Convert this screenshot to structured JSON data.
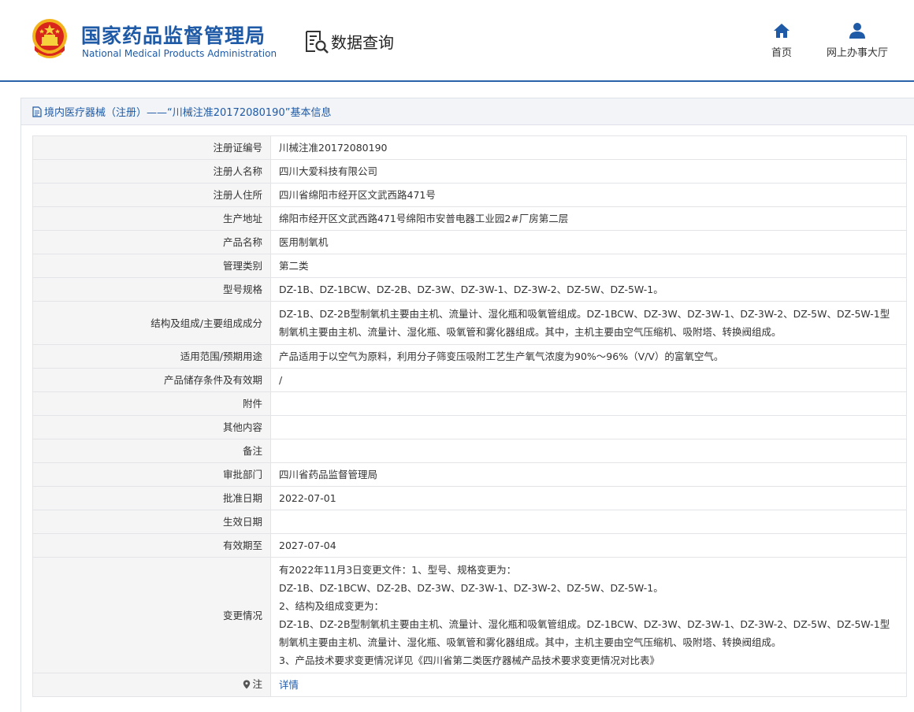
{
  "header": {
    "site_title_cn": "国家药品监督管理局",
    "site_title_en": "National Medical Products Administration",
    "section_label": "数据查询",
    "nav": [
      {
        "label": "首页",
        "icon": "home-icon"
      },
      {
        "label": "网上办事大厅",
        "icon": "user-icon"
      }
    ]
  },
  "panel": {
    "title": "境内医疗器械（注册）——“川械注准20172080190”基本信息"
  },
  "rows": [
    {
      "label": "注册证编号",
      "value": "川械注准20172080190"
    },
    {
      "label": "注册人名称",
      "value": "四川大爱科技有限公司"
    },
    {
      "label": "注册人住所",
      "value": "四川省绵阳市经开区文武西路471号"
    },
    {
      "label": "生产地址",
      "value": "绵阳市经开区文武西路471号绵阳市安普电器工业园2#厂房第二层"
    },
    {
      "label": "产品名称",
      "value": "医用制氧机"
    },
    {
      "label": "管理类别",
      "value": "第二类"
    },
    {
      "label": "型号规格",
      "value": "DZ-1B、DZ-1BCW、DZ-2B、DZ-3W、DZ-3W-1、DZ-3W-2、DZ-5W、DZ-5W-1。"
    },
    {
      "label": "结构及组成/主要组成成分",
      "value": "DZ-1B、DZ-2B型制氧机主要由主机、流量计、湿化瓶和吸氧管组成。DZ-1BCW、DZ-3W、DZ-3W-1、DZ-3W-2、DZ-5W、DZ-5W-1型制氧机主要由主机、流量计、湿化瓶、吸氧管和雾化器组成。其中，主机主要由空气压缩机、吸附塔、转换阀组成。"
    },
    {
      "label": "适用范围/预期用途",
      "value": "产品适用于以空气为原料，利用分子筛变压吸附工艺生产氧气浓度为90%～96%（V/V）的富氧空气。"
    },
    {
      "label": "产品储存条件及有效期",
      "value": "/"
    },
    {
      "label": "附件",
      "value": ""
    },
    {
      "label": "其他内容",
      "value": ""
    },
    {
      "label": "备注",
      "value": ""
    },
    {
      "label": "审批部门",
      "value": "四川省药品监督管理局"
    },
    {
      "label": "批准日期",
      "value": "2022-07-01"
    },
    {
      "label": "生效日期",
      "value": ""
    },
    {
      "label": "有效期至",
      "value": "2027-07-04"
    }
  ],
  "change": {
    "label": "变更情况",
    "lines": [
      "有2022年11月3日变更文件：1、型号、规格变更为：",
      "DZ-1B、DZ-1BCW、DZ-2B、DZ-3W、DZ-3W-1、DZ-3W-2、DZ-5W、DZ-5W-1。",
      "2、结构及组成变更为：",
      "DZ-1B、DZ-2B型制氧机主要由主机、流量计、湿化瓶和吸氧管组成。DZ-1BCW、DZ-3W、DZ-3W-1、DZ-3W-2、DZ-5W、DZ-5W-1型制氧机主要由主机、流量计、湿化瓶、吸氧管和雾化器组成。其中，主机主要由空气压缩机、吸附塔、转换阀组成。",
      "3、产品技术要求变更情况详见《四川省第二类医疗器械产品技术要求变更情况对比表》"
    ]
  },
  "note": {
    "label": "注",
    "link_text": "详情"
  },
  "colors": {
    "brand_blue": "#1f5aa6",
    "header_line": "#2b63a8",
    "label_bg": "#f5f5f5",
    "border": "#e2e4e8"
  }
}
